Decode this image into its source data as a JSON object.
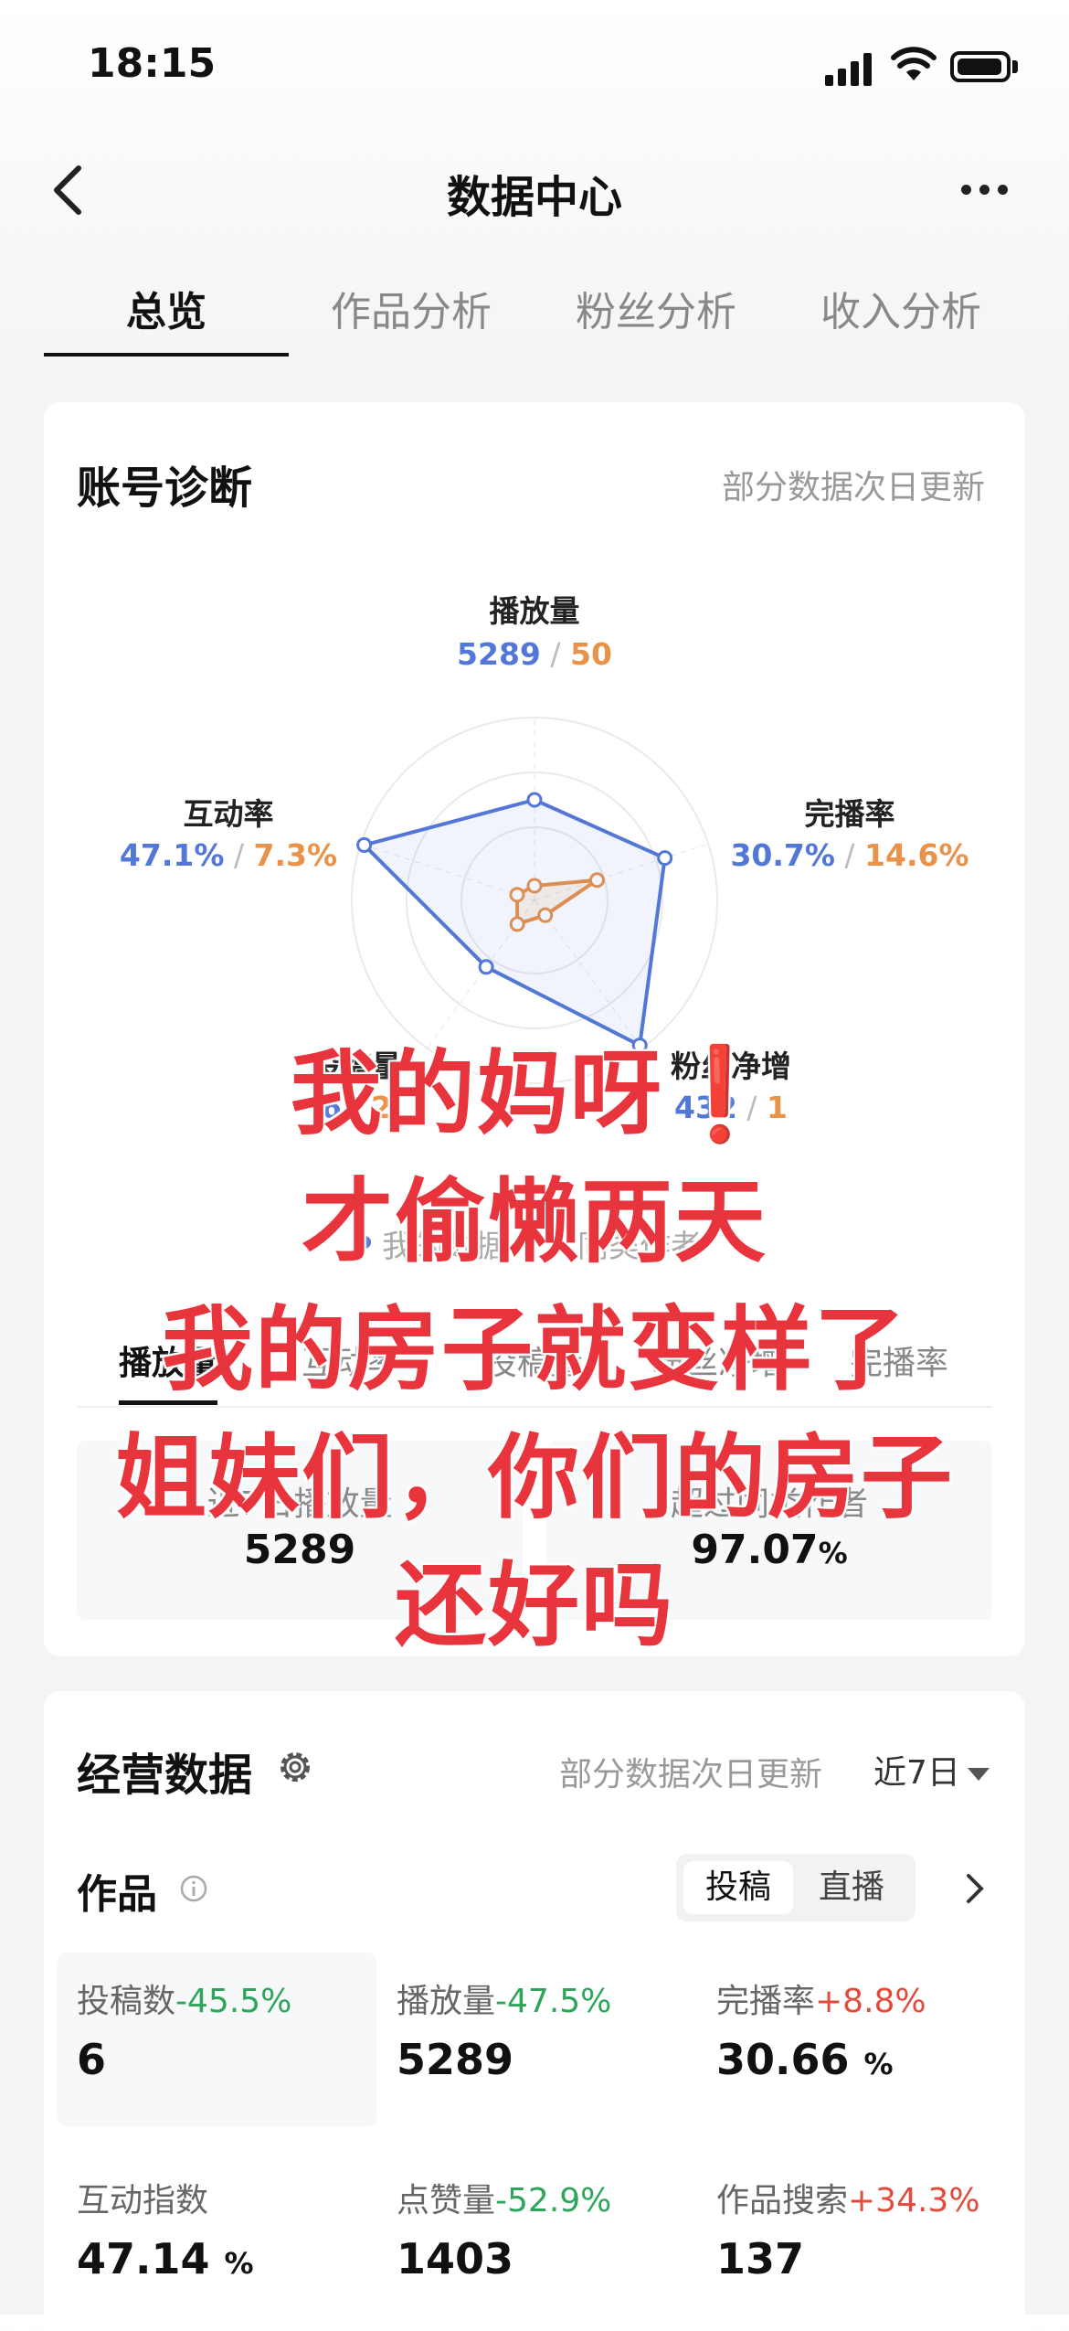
{
  "status_bar": {
    "time": "18:15"
  },
  "nav": {
    "title": "数据中心"
  },
  "tabs": [
    {
      "label": "总览"
    },
    {
      "label": "作品分析"
    },
    {
      "label": "粉丝分析"
    },
    {
      "label": "收入分析"
    }
  ],
  "diagnosis": {
    "title": "账号诊断",
    "note": "部分数据次日更新",
    "radar": [
      {
        "label": "播放量",
        "mine": "5289",
        "peer": "50"
      },
      {
        "label": "完播率",
        "mine": "30.7%",
        "peer": "14.6%"
      },
      {
        "label": "粉丝净增",
        "mine": "432",
        "peer": "1"
      },
      {
        "label": "投稿量",
        "mine": "6",
        "peer": "2"
      },
      {
        "label": "互动率",
        "mine": "47.1%",
        "peer": "7.3%"
      }
    ],
    "legend": {
      "mine": "我的数据",
      "peer": "同类作者"
    },
    "sub_tabs": [
      "播放量",
      "互动率",
      "投稿量",
      "粉丝净增",
      "完播率"
    ],
    "stats": [
      {
        "label": "近7日播放量",
        "value": "5289",
        "unit": ""
      },
      {
        "label": "超过同类作者",
        "value": "97.07",
        "unit": "%"
      }
    ],
    "colors": {
      "mine": "#5277d6",
      "peer": "#e8924a"
    }
  },
  "overlay_text": [
    "我的妈呀❗",
    "才偷懒两天",
    "我的房子就变样了",
    "姐妹们，你们的房子",
    "还好吗"
  ],
  "business": {
    "title": "经营数据",
    "note": "部分数据次日更新",
    "range": "近7日",
    "section": "作品",
    "toggle": [
      "投稿",
      "直播"
    ],
    "metrics": [
      {
        "label": "投稿数",
        "change": "-45.5%",
        "dir": "down",
        "value": "6",
        "unit": ""
      },
      {
        "label": "播放量",
        "change": "-47.5%",
        "dir": "down",
        "value": "5289",
        "unit": ""
      },
      {
        "label": "完播率",
        "change": "+8.8%",
        "dir": "up",
        "value": "30.66",
        "unit": "%"
      },
      {
        "label": "互动指数",
        "change": "",
        "dir": "",
        "value": "47.14",
        "unit": "%"
      },
      {
        "label": "点赞量",
        "change": "-52.9%",
        "dir": "down",
        "value": "1403",
        "unit": ""
      },
      {
        "label": "作品搜索",
        "change": "+34.3%",
        "dir": "up",
        "value": "137",
        "unit": ""
      }
    ]
  }
}
